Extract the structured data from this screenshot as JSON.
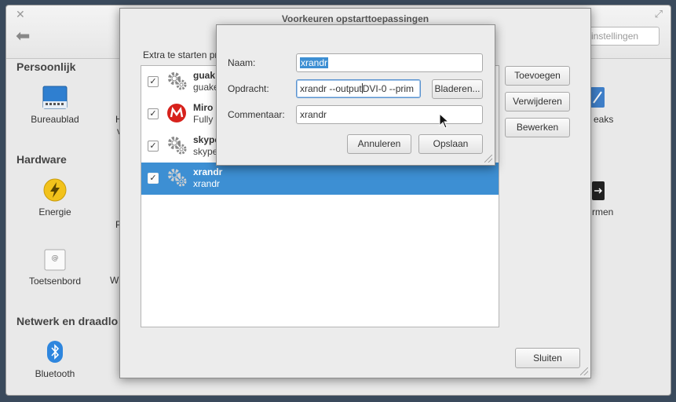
{
  "settings_window": {
    "search_placeholder": "instellingen",
    "sections": {
      "personal": "Persoonlijk",
      "hardware": "Hardware",
      "network": "Netwerk en draadlo"
    },
    "categories": {
      "desktop": "Bureaublad",
      "power": "Energie",
      "keyboard": "Toetsenbord",
      "bluetooth": "Bluetooth"
    },
    "partial_labels": {
      "h": "H",
      "v": "v",
      "p": "P",
      "w": "W",
      "eaks": "eaks",
      "rmen": "rmen"
    }
  },
  "startup_dialog": {
    "title": "Voorkeuren opstarttoepassingen",
    "extra_label": "Extra te starten pr",
    "items": [
      {
        "name": "guak",
        "description": "guake",
        "checked": true,
        "icon": "gear-icon"
      },
      {
        "name": "Miro",
        "description": "Fully",
        "checked": true,
        "icon": "miro-icon"
      },
      {
        "name": "skype",
        "description": "skype",
        "checked": true,
        "icon": "gear-icon"
      },
      {
        "name": "xrandr",
        "description": "xrandr",
        "checked": true,
        "icon": "gear-icon",
        "selected": true
      }
    ],
    "buttons": {
      "add": "Toevoegen",
      "remove": "Verwijderen",
      "edit": "Bewerken",
      "close": "Sluiten"
    }
  },
  "edit_dialog": {
    "name_label": "Naam:",
    "name_value": "xrandr",
    "command_label": "Opdracht:",
    "command_before_caret": "xrandr --output",
    "command_after_caret": "DVI-0 --prim",
    "comment_label": "Commentaar:",
    "comment_value": "xrandr",
    "browse_label": "Bladeren...",
    "cancel_label": "Annuleren",
    "save_label": "Opslaan"
  },
  "colors": {
    "selection": "#3d8fd3",
    "miro_red": "#d7221c",
    "power_yellow": "#f2c21b",
    "bluetooth_blue": "#2e86de"
  },
  "checkmark": "✓"
}
